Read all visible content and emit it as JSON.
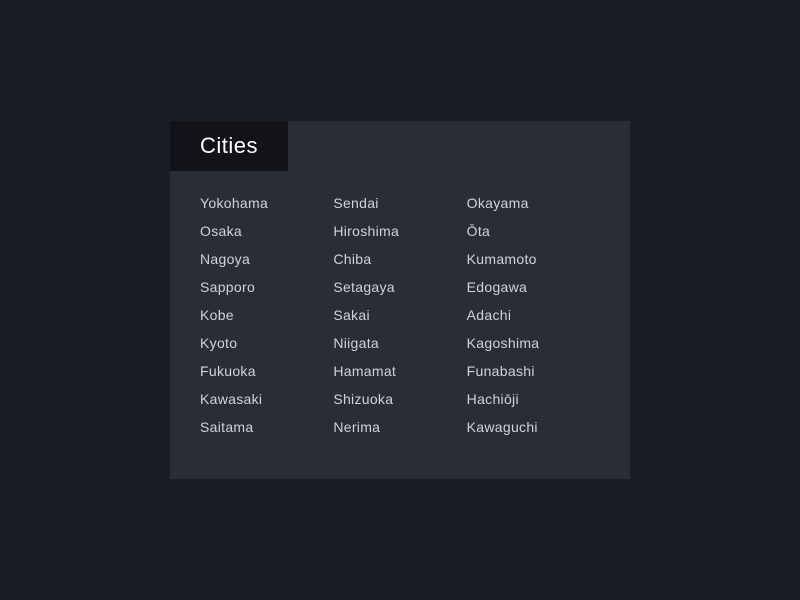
{
  "header": {
    "title": "Cities"
  },
  "colors": {
    "background": "#1a1d26",
    "card": "#2a2d36",
    "titleBar": "#111318",
    "titleText": "#ffffff",
    "cityText": "#d0d3dc"
  },
  "columns": [
    {
      "id": "col1",
      "cities": [
        "Yokohama",
        "Osaka",
        "Nagoya",
        "Sapporo",
        "Kobe",
        "Kyoto",
        "Fukuoka",
        "Kawasaki",
        "Saitama"
      ]
    },
    {
      "id": "col2",
      "cities": [
        "Sendai",
        "Hiroshima",
        "Chiba",
        "Setagaya",
        "Sakai",
        "Niigata",
        "Hamamat",
        "Shizuoka",
        "Nerima"
      ]
    },
    {
      "id": "col3",
      "cities": [
        "Okayama",
        "Ōta",
        "Kumamoto",
        "Edogawa",
        "Adachi",
        "Kagoshima",
        "Funabashi",
        "Hachiōji",
        "Kawaguchi"
      ]
    }
  ]
}
